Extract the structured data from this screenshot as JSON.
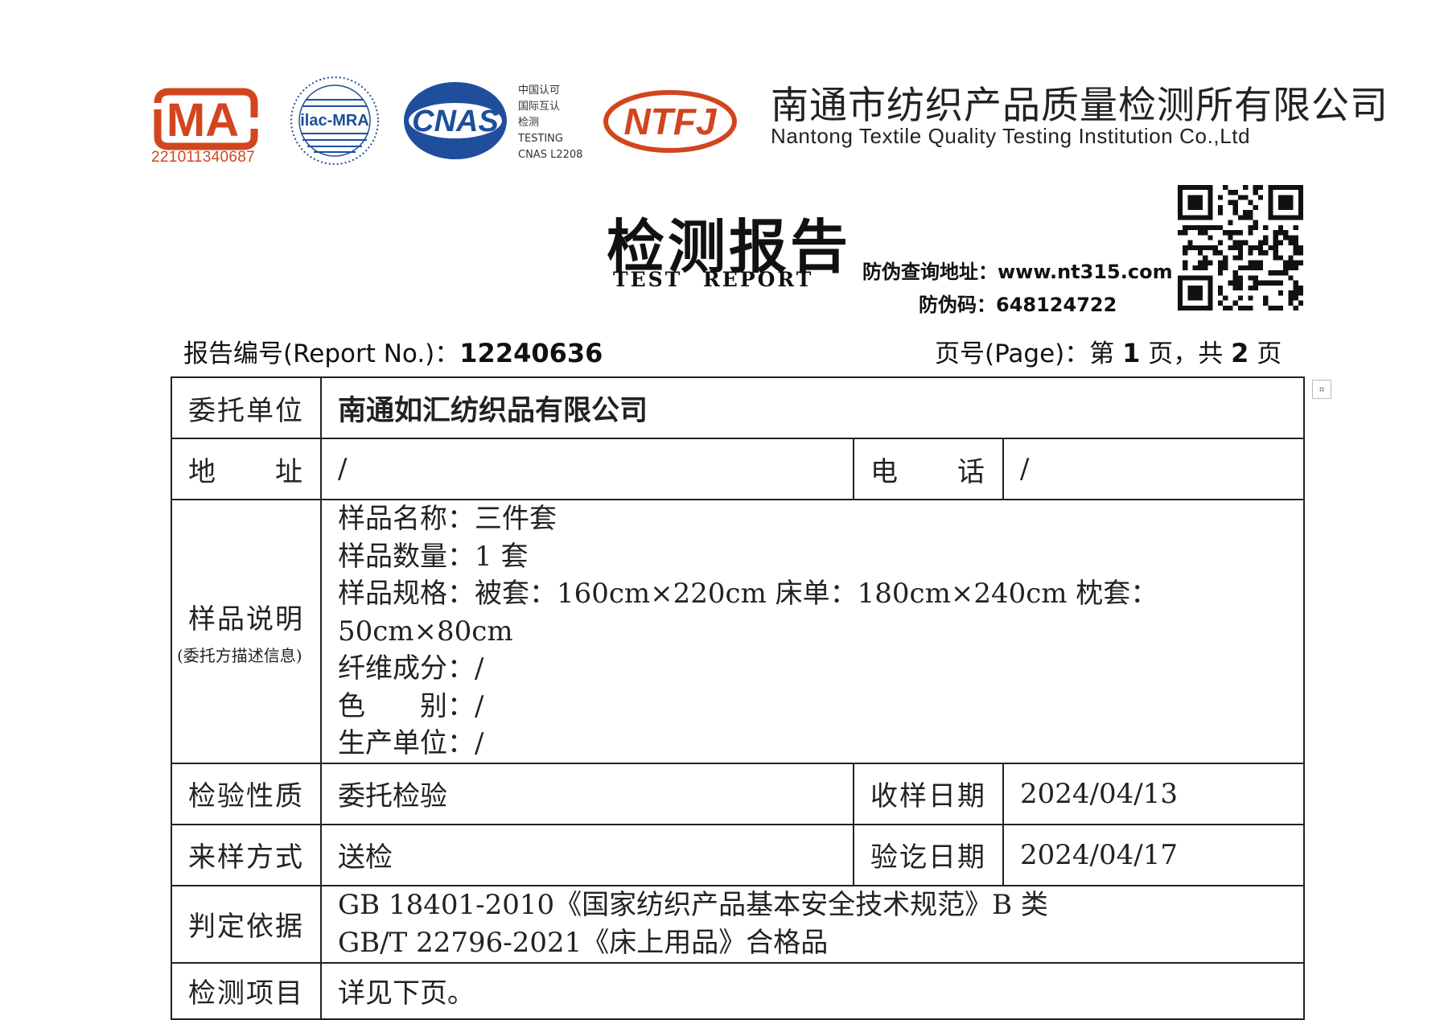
{
  "header": {
    "ma_logo_text": "MA",
    "ma_number": "221011340687",
    "ilac_logo_text": "ilac-MRA",
    "cnas_logo_text": "CNAS",
    "cnas_lines": [
      "中国认可",
      "国际互认",
      "检测",
      "TESTING",
      "CNAS L2208"
    ],
    "ntfj_logo_text": "NTFJ",
    "company_cn": "南通市纺织产品质量检测所有限公司",
    "company_en": "Nantong Textile Quality Testing Institution Co.,Ltd"
  },
  "title": {
    "cn": "检测报告",
    "en": "TEST REPORT"
  },
  "verify": {
    "address_label": "防伪查询地址：",
    "address_value": "www.nt315.com",
    "code_label": "防伪码：",
    "code_value": "648124722"
  },
  "report": {
    "no_label": "报告编号(Report No.)：",
    "no_value": "12240636",
    "page_label": "页号(Page)：第",
    "page_current": "1",
    "page_mid": "页，共",
    "page_total": "2",
    "page_end": "页"
  },
  "table": {
    "client_label": "委托单位",
    "client_value": "南通如汇纺织品有限公司",
    "address_label_a": "地",
    "address_label_b": "址",
    "address_value": "/",
    "phone_label_a": "电",
    "phone_label_b": "话",
    "phone_value": "/",
    "sample_label": "样品说明",
    "sample_sublabel": "(委托方描述信息)",
    "sample_lines": [
      "样品名称：三件套",
      "样品数量：1 套",
      "样品规格：被套：160cm×220cm 床单：180cm×240cm 枕套：50cm×80cm",
      "纤维成分：/",
      "色　　别：/",
      "生产单位：/"
    ],
    "nature_label": "检验性质",
    "nature_value": "委托检验",
    "receive_label": "收样日期",
    "receive_value": "2024/04/13",
    "method_label": "来样方式",
    "method_value": "送检",
    "finish_label": "验讫日期",
    "finish_value": "2024/04/17",
    "basis_label": "判定依据",
    "basis_lines": [
      "GB 18401-2010《国家纺织产品基本安全技术规范》B 类",
      "GB/T 22796-2021《床上用品》合格品"
    ],
    "items_label": "检测项目",
    "items_value": "详见下页。"
  },
  "colors": {
    "logo_red": "#d2451e",
    "cnas_blue": "#1f4e9c",
    "ilac_blue": "#1d4f9a"
  }
}
